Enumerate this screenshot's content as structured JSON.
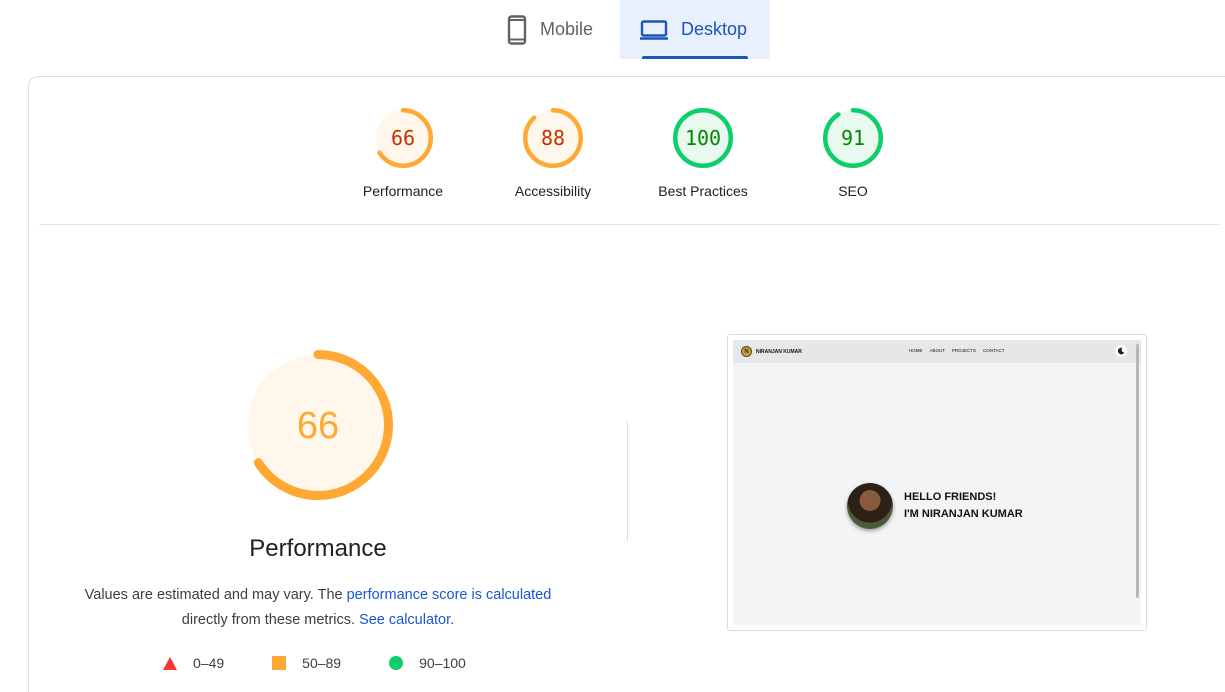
{
  "tabs": [
    {
      "label": "Mobile",
      "icon": "phone-icon",
      "selected": false
    },
    {
      "label": "Desktop",
      "icon": "laptop-icon",
      "selected": true
    }
  ],
  "scores": [
    {
      "label": "Performance",
      "value": "66",
      "score": 66,
      "status": "average",
      "color": "#ffa833",
      "text_color": "#c33300",
      "bg": "#fff7eb"
    },
    {
      "label": "Accessibility",
      "value": "88",
      "score": 88,
      "status": "average",
      "color": "#ffa833",
      "text_color": "#c33300",
      "bg": "#fff7eb"
    },
    {
      "label": "Best Practices",
      "value": "100",
      "score": 100,
      "status": "pass",
      "color": "#0cce6b",
      "text_color": "#008800",
      "bg": "#e9f9ef"
    },
    {
      "label": "SEO",
      "value": "91",
      "score": 91,
      "status": "pass",
      "color": "#0cce6b",
      "text_color": "#008800",
      "bg": "#e9f9ef"
    }
  ],
  "performance": {
    "title": "Performance",
    "score": "66",
    "score_value": 66,
    "color": "#ffa833",
    "desc_prefix": "Values are estimated and may vary. The ",
    "desc_link": "performance score is calculated",
    "desc_middle": " directly from these metrics. ",
    "desc_link2": "See calculator",
    "desc_suffix": "."
  },
  "legend": [
    {
      "range": "0–49",
      "shape": "triangle",
      "color": "#ff3333"
    },
    {
      "range": "50–89",
      "shape": "square",
      "color": "#ffa833"
    },
    {
      "range": "90–100",
      "shape": "circle",
      "color": "#0cce6b"
    }
  ],
  "screenshot": {
    "site_name": "NIRANJAN KUMAR",
    "logo_letter": "N",
    "nav": [
      "HOME",
      "ABOUT",
      "PROJECTS",
      "CONTACT"
    ],
    "hero_line1": "HELLO FRIENDS!",
    "hero_line2": "I'M NIRANJAN KUMAR"
  }
}
